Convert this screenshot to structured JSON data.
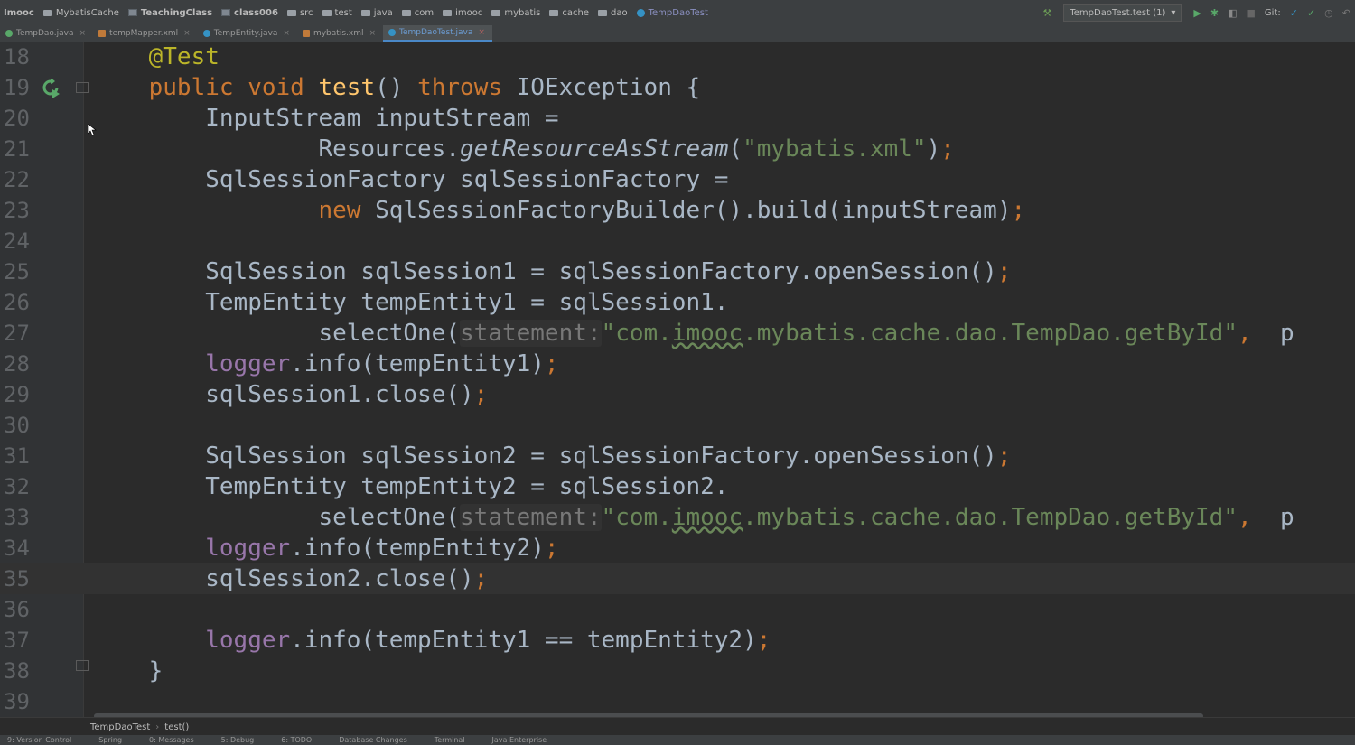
{
  "navbar": {
    "crumbs": [
      "Imooc",
      "MybatisCache",
      "TeachingClass",
      "class006",
      "src",
      "test",
      "java",
      "com",
      "imooc",
      "mybatis",
      "cache",
      "dao",
      "TempDaoTest"
    ],
    "run_config": "TempDaoTest.test (1)",
    "git_label": "Git:"
  },
  "tabs": [
    {
      "label": "TempDao.java",
      "close": "×"
    },
    {
      "label": "tempMapper.xml",
      "close": "×"
    },
    {
      "label": "TempEntity.java",
      "close": "×"
    },
    {
      "label": "mybatis.xml",
      "close": "×"
    },
    {
      "label": "TempDaoTest.java",
      "close": "×"
    }
  ],
  "line_numbers": [
    "18",
    "19",
    "20",
    "21",
    "22",
    "23",
    "24",
    "25",
    "26",
    "27",
    "28",
    "29",
    "30",
    "31",
    "32",
    "33",
    "34",
    "35",
    "36",
    "37",
    "38",
    "39"
  ],
  "code": {
    "l18_ann": "@Test",
    "l19_kw1": "public",
    "l19_kw2": "void",
    "l19_fn": "test",
    "l19_parens": "()",
    "l19_kw3": "throws",
    "l19_rest": "IOException {",
    "l20": "InputStream inputStream =",
    "l21_a": "Resources.",
    "l21_m": "getResourceAsStream",
    "l21_p": "(",
    "l21_s": "\"mybatis.xml\"",
    "l21_e": ")",
    "semi": ";",
    "l22": "SqlSessionFactory sqlSessionFactory =",
    "l23_kw": "new",
    "l23_rest": "SqlSessionFactoryBuilder().build(inputStream)",
    "l25": "SqlSession sqlSession1 = sqlSessionFactory.openSession()",
    "l26": "TempEntity tempEntity1 = sqlSession1.",
    "l27_a": "selectOne(",
    "hint": "statement:",
    "str_a": "\"com.",
    "str_imooc": "imooc",
    "str_b": ".mybatis.cache.dao.TempDao.getById\"",
    "comma": ",",
    "trail": "p",
    "logger": "logger",
    "l28_rest": ".info(tempEntity1)",
    "l29": "sqlSession1.close()",
    "l31": "SqlSession sqlSession2 = sqlSessionFactory.openSession()",
    "l32": "TempEntity tempEntity2 = sqlSession2.",
    "l34_rest": ".info(tempEntity2)",
    "l35": "sqlSession2.close()",
    "l37_rest": ".info(tempEntity1 == tempEntity2)",
    "l38": "}"
  },
  "breadcrumb": {
    "class_name": "TempDaoTest",
    "sep": "›",
    "method": "test()"
  },
  "statusbar": [
    "9: Version Control",
    "Spring",
    "0: Messages",
    "5: Debug",
    "6: TODO",
    "Database Changes",
    "Terminal",
    "Java Enterprise"
  ],
  "colors": {
    "keyword": "#cc7832",
    "string": "#6a8759",
    "annotation": "#bbb529",
    "method": "#ffc66d",
    "field": "#9876aa",
    "background": "#2b2b2b"
  }
}
